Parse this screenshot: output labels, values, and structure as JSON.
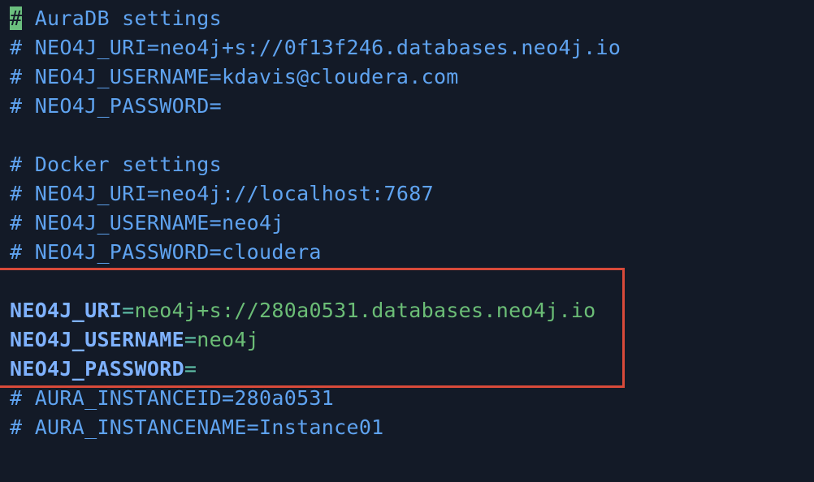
{
  "editor": {
    "aura_section": {
      "cursor_char": "#",
      "header": " AuraDB settings",
      "uri": "# NEO4J_URI=neo4j+s://0f13f246.databases.neo4j.io",
      "username": "# NEO4J_USERNAME=kdavis@cloudera.com",
      "password": "# NEO4J_PASSWORD="
    },
    "docker_section": {
      "header": "# Docker settings",
      "uri": "# NEO4J_URI=neo4j://localhost:7687",
      "username": "# NEO4J_USERNAME=neo4j",
      "password": "# NEO4J_PASSWORD=cloudera"
    },
    "active_section": {
      "uri_key": "NEO4J_URI",
      "uri_value": "neo4j+s://280a0531.databases.neo4j.io",
      "username_key": "NEO4J_USERNAME",
      "username_value": "neo4j",
      "password_key": "NEO4J_PASSWORD",
      "password_value": "",
      "equals": "="
    },
    "instance_section": {
      "instance_id": "# AURA_INSTANCEID=280a0531",
      "instance_name": "# AURA_INSTANCENAME=Instance01"
    },
    "colors": {
      "background": "#131a27",
      "comment": "#5fa3f0",
      "key": "#7fb2ff",
      "value": "#6bbd76",
      "cursor": "#6bbf7e",
      "highlight_border": "#d84a3a"
    }
  }
}
